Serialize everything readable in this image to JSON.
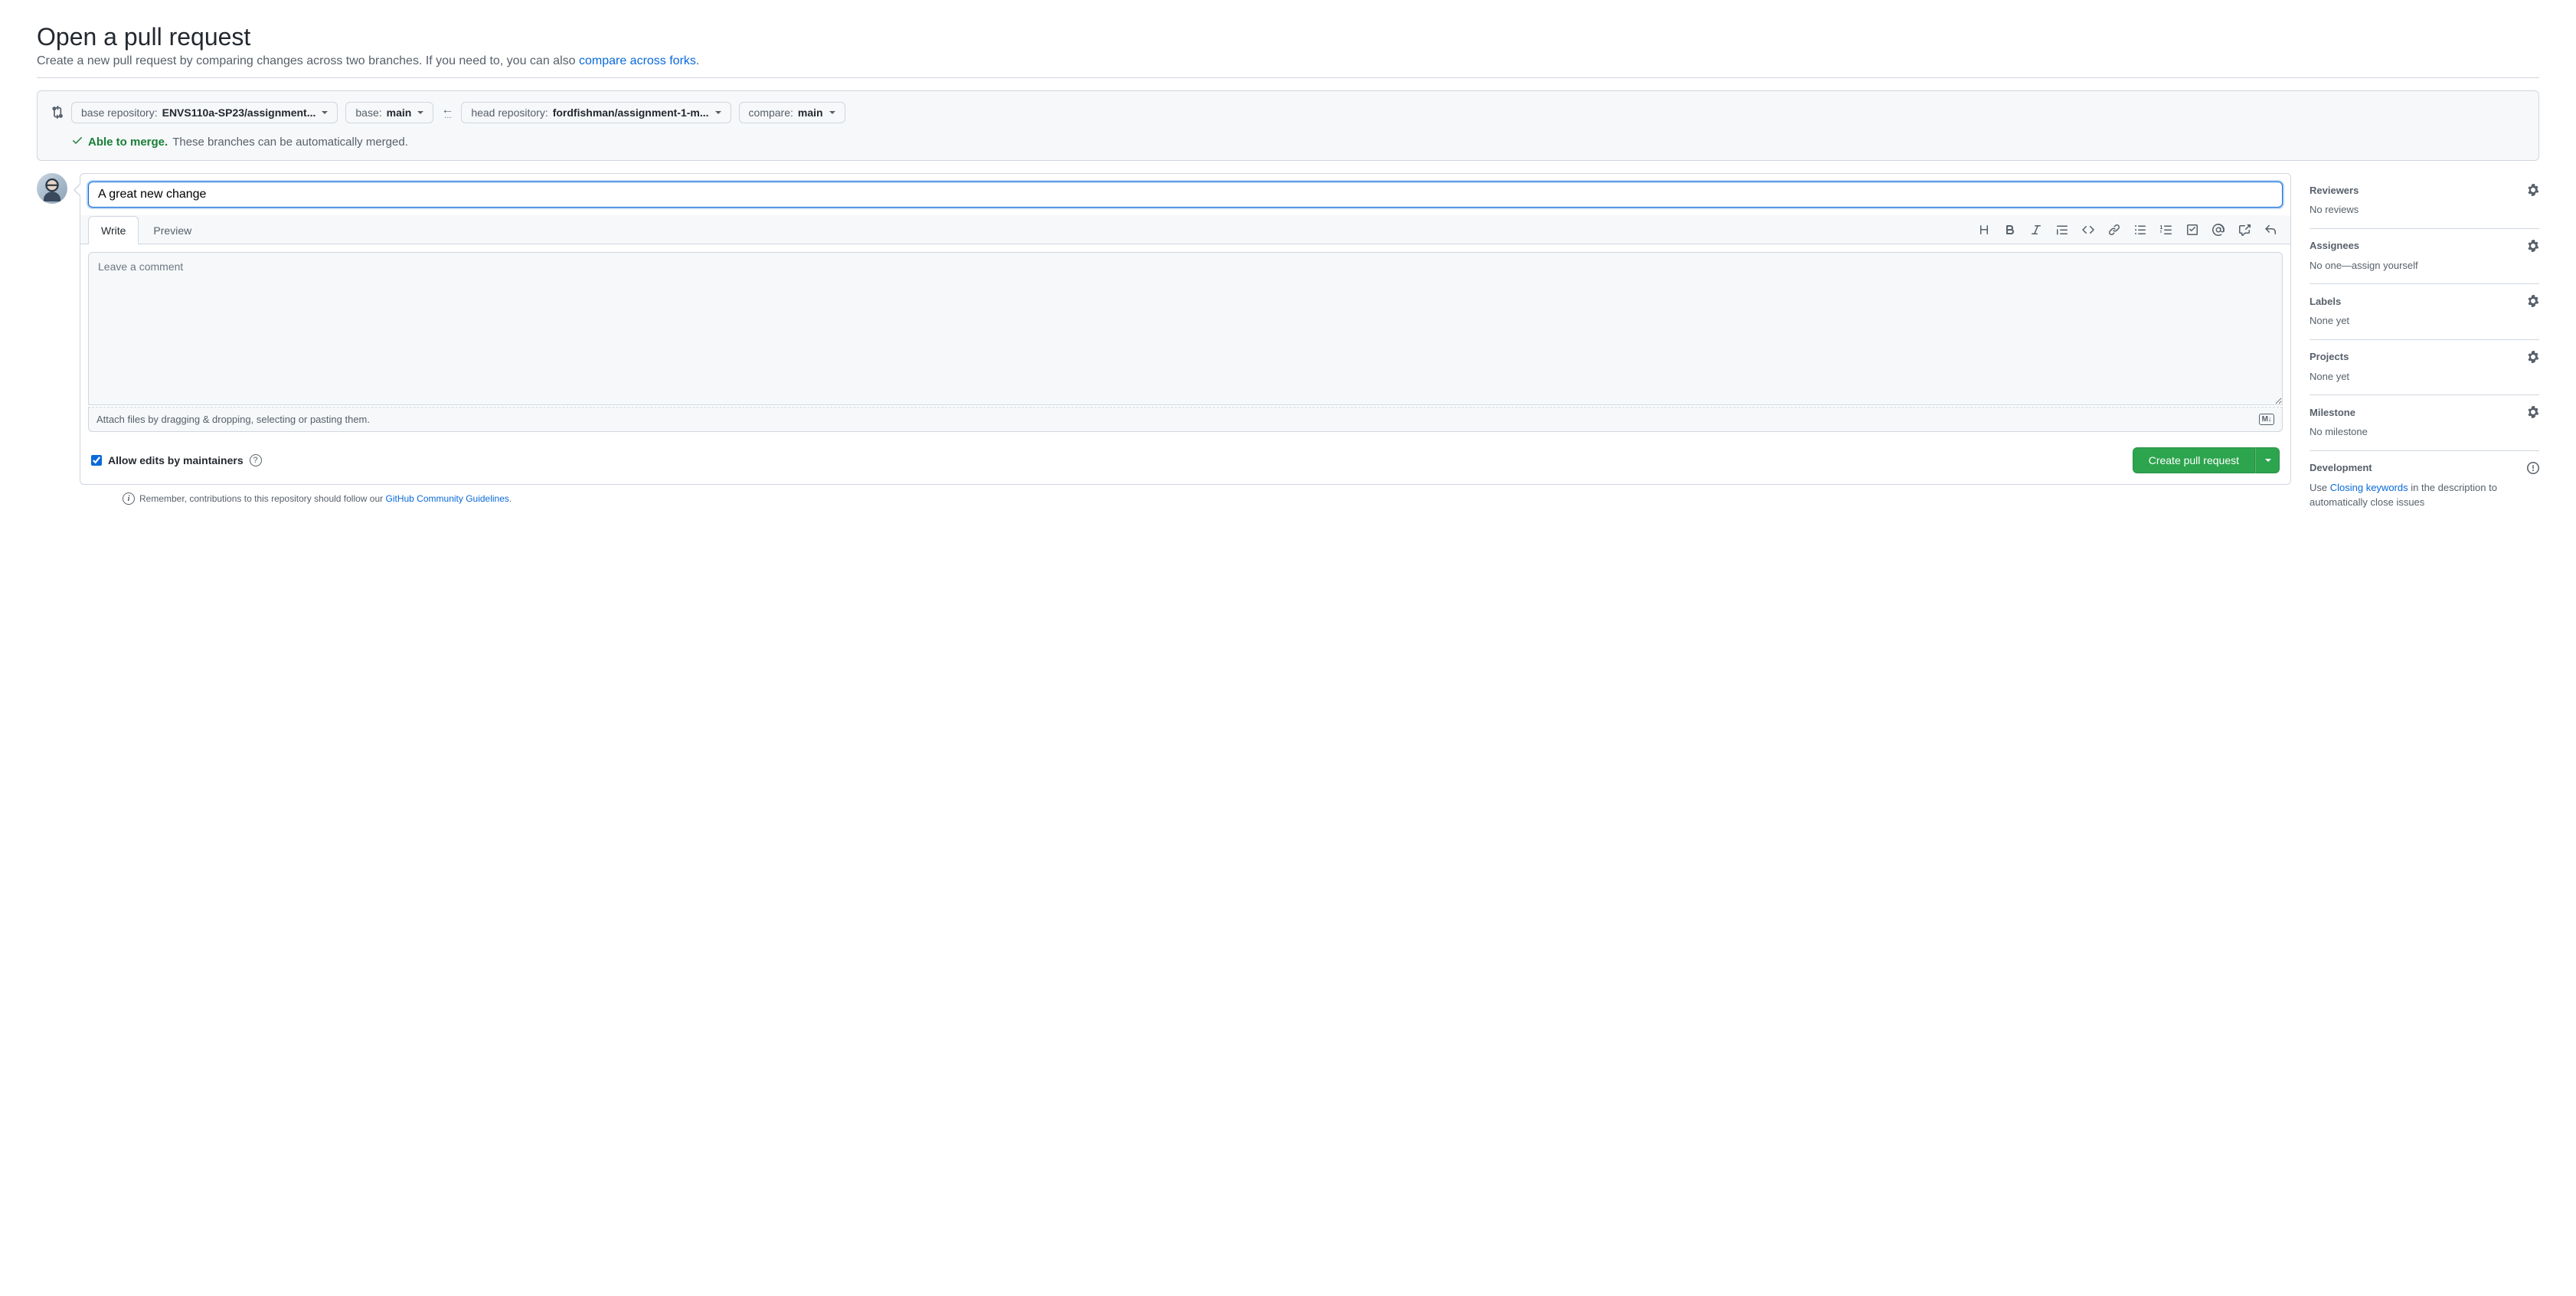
{
  "header": {
    "title": "Open a pull request",
    "subtitle_pre": "Create a new pull request by comparing changes across two branches. If you need to, you can also ",
    "compare_link": "compare across forks",
    "subtitle_post": "."
  },
  "compare": {
    "base_repo_label": "base repository: ",
    "base_repo_value": "ENVS110a-SP23/assignment...",
    "base_label": "base: ",
    "base_value": "main",
    "head_repo_label": "head repository: ",
    "head_repo_value": "fordfishman/assignment-1-m...",
    "compare_label": "compare: ",
    "compare_value": "main",
    "merge_able": "Able to merge.",
    "merge_rest": "These branches can be automatically merged."
  },
  "form": {
    "title_value": "A great new change",
    "tabs": {
      "write": "Write",
      "preview": "Preview"
    },
    "comment_placeholder": "Leave a comment",
    "attach_hint": "Attach files by dragging & dropping, selecting or pasting them.",
    "md_badge": "M↓",
    "allow_edits_label": "Allow edits by maintainers",
    "create_label": "Create pull request"
  },
  "footnote": {
    "pre": "Remember, contributions to this repository should follow our ",
    "link": "GitHub Community Guidelines",
    "post": "."
  },
  "sidebar": {
    "reviewers": {
      "title": "Reviewers",
      "text": "No reviews"
    },
    "assignees": {
      "title": "Assignees",
      "text_pre": "No one—",
      "assign_self": "assign yourself"
    },
    "labels": {
      "title": "Labels",
      "text": "None yet"
    },
    "projects": {
      "title": "Projects",
      "text": "None yet"
    },
    "milestone": {
      "title": "Milestone",
      "text": "No milestone"
    },
    "development": {
      "title": "Development",
      "text_pre": "Use ",
      "link": "Closing keywords",
      "text_post": " in the description to automatically close issues"
    }
  },
  "icons": {
    "gear": "gear-icon",
    "info": "info-icon"
  }
}
